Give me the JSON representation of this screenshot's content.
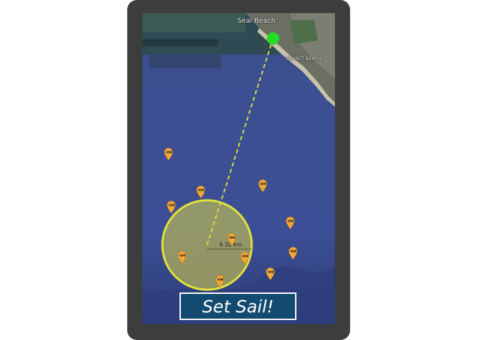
{
  "map": {
    "place_labels": {
      "seal_beach": "Seal Beach",
      "sunset_beach": "SUNSET BEACH"
    },
    "distance_label": "6.32 km",
    "colors": {
      "ocean": "#3d4f93",
      "land": "#6b6f63",
      "range_circle": "#c9c95a",
      "range_circle_stroke": "#e3e33a",
      "route_line": "#d6e23c",
      "start_marker": "#22dd22",
      "fish_marker": "#f3a83a"
    },
    "icons": {
      "fish_spot": "fish-marker-icon",
      "start": "start-location-dot-icon"
    },
    "fishing_spot_count": 11
  },
  "actions": {
    "set_sail_label": "Set Sail!"
  }
}
